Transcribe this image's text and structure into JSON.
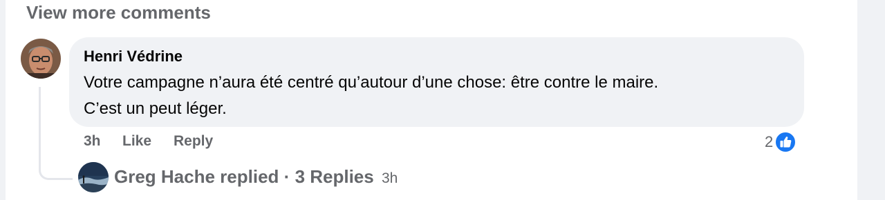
{
  "view_more_label": "View more comments",
  "comment": {
    "author": "Henri Védrine",
    "text_line1": "Votre campagne n’aura été centré qu’autour d’une chose: être contre le maire.",
    "text_line2": "C’est un peut léger.",
    "time": "3h",
    "like_label": "Like",
    "reply_label": "Reply",
    "reaction_count": "2",
    "reaction_icon": "thumbs-up-icon"
  },
  "replies_summary": {
    "author_replied": "Greg Hache replied",
    "separator": "·",
    "count_label": "3 Replies",
    "time": "3h"
  },
  "colors": {
    "secondary_text": "#65676b",
    "bubble_bg": "#f0f2f5",
    "like_blue": "#1877f2"
  }
}
